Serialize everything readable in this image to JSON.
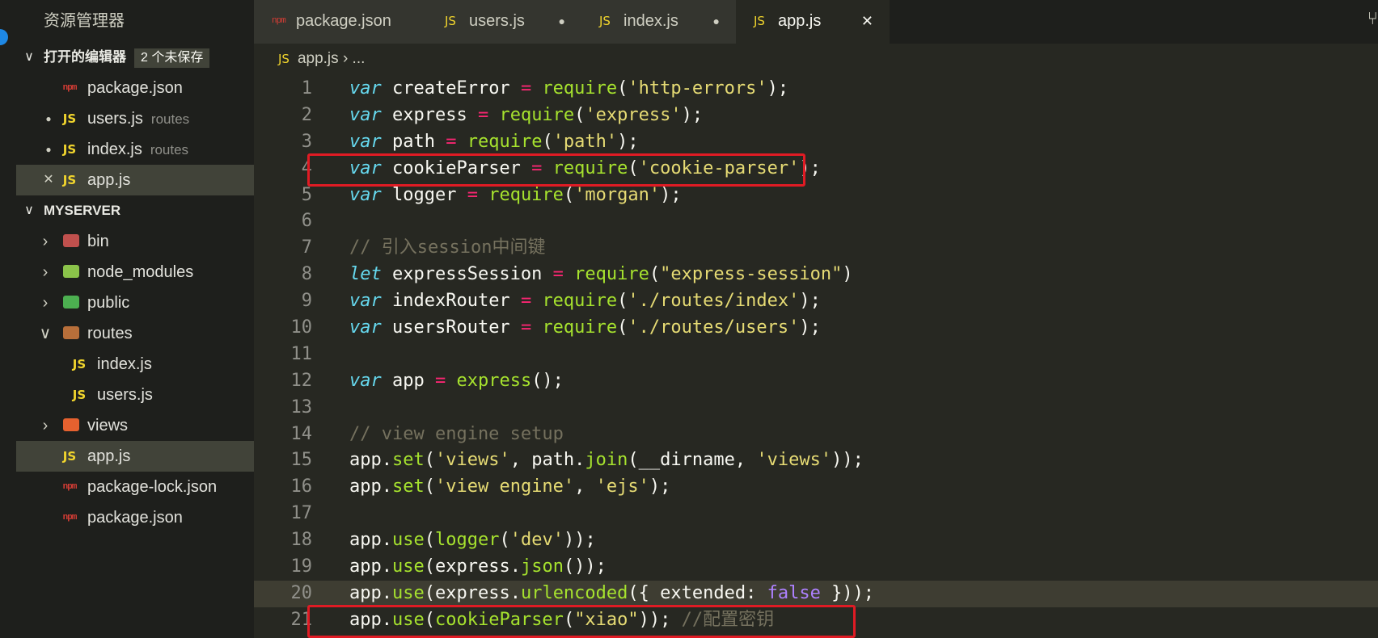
{
  "sidebar": {
    "title": "资源管理器",
    "open_editors": {
      "label": "打开的编辑器",
      "badge": "2 个未保存",
      "items": [
        {
          "icon": "npm",
          "name": "package.json",
          "desc": "",
          "state": ""
        },
        {
          "icon": "JS",
          "name": "users.js",
          "desc": "routes",
          "state": "unsaved"
        },
        {
          "icon": "JS",
          "name": "index.js",
          "desc": "routes",
          "state": "unsaved"
        },
        {
          "icon": "JS",
          "name": "app.js",
          "desc": "",
          "state": "close"
        }
      ]
    },
    "project": {
      "label": "MYSERVER",
      "items": [
        {
          "type": "folder",
          "name": "bin",
          "icon": "folder-bin-icon",
          "open": false,
          "depth": 0
        },
        {
          "type": "folder",
          "name": "node_modules",
          "icon": "folder-node-icon",
          "open": false,
          "depth": 0
        },
        {
          "type": "folder",
          "name": "public",
          "icon": "folder-public-icon",
          "open": false,
          "depth": 0
        },
        {
          "type": "folder",
          "name": "routes",
          "icon": "folder-routes-icon",
          "open": true,
          "depth": 0
        },
        {
          "type": "file",
          "name": "index.js",
          "icon": "JS",
          "depth": 1
        },
        {
          "type": "file",
          "name": "users.js",
          "icon": "JS",
          "depth": 1
        },
        {
          "type": "folder",
          "name": "views",
          "icon": "folder-views-icon",
          "open": false,
          "depth": 0
        },
        {
          "type": "file",
          "name": "app.js",
          "icon": "JS",
          "depth": 0,
          "selected": true
        },
        {
          "type": "file",
          "name": "package-lock.json",
          "icon": "npm",
          "depth": 0
        },
        {
          "type": "file",
          "name": "package.json",
          "icon": "npm",
          "depth": 0
        }
      ]
    }
  },
  "tabs": [
    {
      "icon": "npm",
      "label": "package.json",
      "state": "",
      "active": false
    },
    {
      "icon": "JS",
      "label": "users.js",
      "state": "●",
      "active": false
    },
    {
      "icon": "JS",
      "label": "index.js",
      "state": "●",
      "active": false
    },
    {
      "icon": "JS",
      "label": "app.js",
      "state": "✕",
      "active": true
    }
  ],
  "breadcrumb": {
    "icon": "JS",
    "file": "app.js",
    "sep": "›",
    "rest": "..."
  },
  "editor": {
    "highlighted_line": 20,
    "boxed_lines": [
      4,
      21
    ],
    "lines": [
      [
        [
          "kw",
          "var"
        ],
        [
          "",
          "createError "
        ],
        [
          "op",
          "="
        ],
        [
          "",
          " "
        ],
        [
          "fn",
          "require"
        ],
        [
          "",
          "("
        ],
        [
          "st",
          "'http-errors'"
        ],
        [
          "",
          ");"
        ]
      ],
      [
        [
          "kw",
          "var"
        ],
        [
          "",
          "express "
        ],
        [
          "op",
          "="
        ],
        [
          "",
          " "
        ],
        [
          "fn",
          "require"
        ],
        [
          "",
          "("
        ],
        [
          "st",
          "'express'"
        ],
        [
          "",
          ");"
        ]
      ],
      [
        [
          "kw",
          "var"
        ],
        [
          "",
          "path "
        ],
        [
          "op",
          "="
        ],
        [
          "",
          " "
        ],
        [
          "fn",
          "require"
        ],
        [
          "",
          "("
        ],
        [
          "st",
          "'path'"
        ],
        [
          "",
          ");"
        ]
      ],
      [
        [
          "kw",
          "var"
        ],
        [
          "",
          "cookieParser "
        ],
        [
          "op",
          "="
        ],
        [
          "",
          " "
        ],
        [
          "fn",
          "require"
        ],
        [
          "",
          "("
        ],
        [
          "st",
          "'cookie-parser'"
        ],
        [
          "",
          ");"
        ]
      ],
      [
        [
          "kw",
          "var"
        ],
        [
          "",
          "logger "
        ],
        [
          "op",
          "="
        ],
        [
          "",
          " "
        ],
        [
          "fn",
          "require"
        ],
        [
          "",
          "("
        ],
        [
          "st",
          "'morgan'"
        ],
        [
          "",
          ");"
        ]
      ],
      [],
      [
        [
          "cm",
          "// 引入session中间键"
        ]
      ],
      [
        [
          "kw",
          "let"
        ],
        [
          "",
          "expressSession "
        ],
        [
          "op",
          "="
        ],
        [
          "",
          " "
        ],
        [
          "fn",
          "require"
        ],
        [
          "",
          "("
        ],
        [
          "st",
          "\"express-session\""
        ],
        [
          "",
          ")"
        ]
      ],
      [
        [
          "kw",
          "var"
        ],
        [
          "",
          "indexRouter "
        ],
        [
          "op",
          "="
        ],
        [
          "",
          " "
        ],
        [
          "fn",
          "require"
        ],
        [
          "",
          "("
        ],
        [
          "st",
          "'./routes/index'"
        ],
        [
          "",
          ");"
        ]
      ],
      [
        [
          "kw",
          "var"
        ],
        [
          "",
          "usersRouter "
        ],
        [
          "op",
          "="
        ],
        [
          "",
          " "
        ],
        [
          "fn",
          "require"
        ],
        [
          "",
          "("
        ],
        [
          "st",
          "'./routes/users'"
        ],
        [
          "",
          ");"
        ]
      ],
      [],
      [
        [
          "kw",
          "var"
        ],
        [
          "",
          "app "
        ],
        [
          "op",
          "="
        ],
        [
          "",
          " "
        ],
        [
          "fn",
          "express"
        ],
        [
          "",
          "();"
        ]
      ],
      [],
      [
        [
          "cm",
          "// view engine setup"
        ]
      ],
      [
        [
          "",
          "app."
        ],
        [
          "fn",
          "set"
        ],
        [
          "",
          "("
        ],
        [
          "st",
          "'views'"
        ],
        [
          "",
          ", path."
        ],
        [
          "fn",
          "join"
        ],
        [
          "",
          "(__dirname, "
        ],
        [
          "st",
          "'views'"
        ],
        [
          "",
          "));"
        ]
      ],
      [
        [
          "",
          "app."
        ],
        [
          "fn",
          "set"
        ],
        [
          "",
          "("
        ],
        [
          "st",
          "'view engine'"
        ],
        [
          "",
          ", "
        ],
        [
          "st",
          "'ejs'"
        ],
        [
          "",
          ");"
        ]
      ],
      [],
      [
        [
          "",
          "app."
        ],
        [
          "fn",
          "use"
        ],
        [
          "",
          "("
        ],
        [
          "fn",
          "logger"
        ],
        [
          "",
          "("
        ],
        [
          "st",
          "'dev'"
        ],
        [
          "",
          "));"
        ]
      ],
      [
        [
          "",
          "app."
        ],
        [
          "fn",
          "use"
        ],
        [
          "",
          "(express."
        ],
        [
          "fn",
          "json"
        ],
        [
          "",
          "());"
        ]
      ],
      [
        [
          "",
          "app."
        ],
        [
          "fn",
          "use"
        ],
        [
          "",
          "(express."
        ],
        [
          "fn",
          "urlencoded"
        ],
        [
          "",
          "({ extended: "
        ],
        [
          "bl",
          "false"
        ],
        [
          "",
          " }));"
        ]
      ],
      [
        [
          "",
          "app."
        ],
        [
          "fn",
          "use"
        ],
        [
          "",
          "("
        ],
        [
          "fn",
          "cookieParser"
        ],
        [
          "",
          "("
        ],
        [
          "st",
          "\"xiao\""
        ],
        [
          "",
          "));"
        ],
        [
          "cm",
          " //配置密钥"
        ]
      ]
    ]
  }
}
